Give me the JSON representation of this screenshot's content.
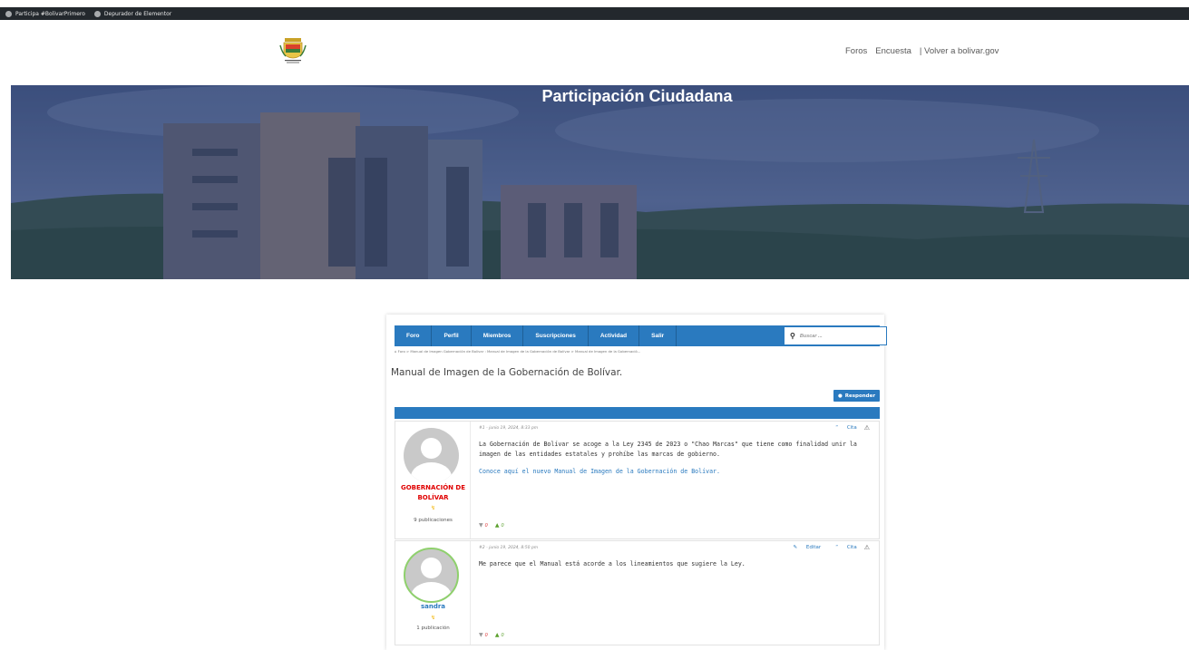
{
  "admin_bar": {
    "item1": "Participa #BolivarPrimero",
    "item2": "Depurador de Elementor"
  },
  "nav": {
    "items": [
      "Foros",
      "Encuesta",
      "| Volver a bolivar.gov"
    ]
  },
  "hero": {
    "title": "Participación Ciudadana"
  },
  "forum": {
    "menu": [
      "Foro",
      "Perfil",
      "Miembros",
      "Suscripciones",
      "Actividad",
      "Salir"
    ],
    "search_placeholder": "Buscar ...",
    "breadcrumb": "Foro  >  Manual de Imagen Gobernación de Bolívar : Manual de Imagen de la Gobernación de Bolívar  >  Manual de Imagen de la Gobernació...",
    "topic_title": "Manual de Imagen de la Gobernación de Bolívar.",
    "reply_label": "Responder",
    "posts": [
      {
        "meta": "#1 - junio 19, 2024, 8:33 pm",
        "author": "GOBERNACIÓN DE BOLÍVAR",
        "publications": "9 publicaciones",
        "text": "La Gobernación de Bolívar se acoge a la Ley 2345 de 2023 o \"Chao Marcas\" que tiene como finalidad unir la imagen de las entidades estatales y prohíbe las marcas de gobierno.",
        "link": "Conoce aquí el nuevo Manual de Imagen de la Gobernación de Bolívar.",
        "quote": "Cita",
        "down": "0",
        "up": "0"
      },
      {
        "meta": "#2 - junio 19, 2024, 8:50 pm",
        "author": "sandra",
        "publications": "1 publicación",
        "text": "Me parece que el Manual está acorde a los lineamientos que sugiere la Ley.",
        "edit": "Editar",
        "quote": "Cita",
        "down": "0",
        "up": "0"
      }
    ]
  },
  "colors": {
    "accent": "#2a7abf",
    "admin_bar": "#23282d",
    "author_red": "#e00000"
  },
  "icons": [
    "wordpress-icon",
    "elementor-icon",
    "search-icon",
    "home-icon",
    "comment-icon",
    "quote-icon",
    "warning-icon",
    "pencil-icon",
    "thumbs-down-icon",
    "thumbs-up-icon",
    "spark-icon"
  ]
}
